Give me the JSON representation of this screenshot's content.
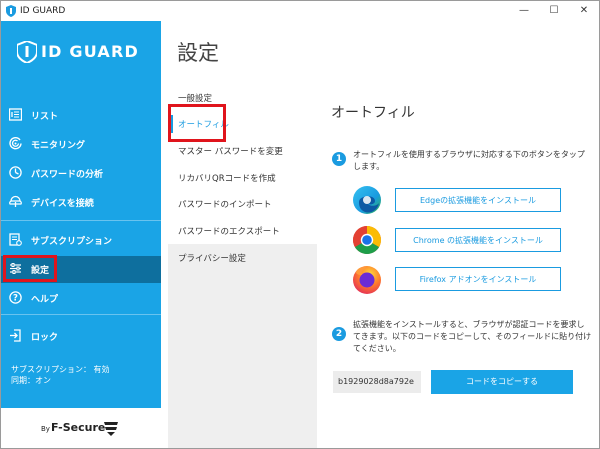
{
  "window": {
    "title": "ID GUARD",
    "minimize": "—",
    "maximize": "☐",
    "close": "✕"
  },
  "sidebar": {
    "logo_text": "ID GUARD",
    "items": [
      {
        "label": "リスト",
        "icon": "list-icon"
      },
      {
        "label": "モニタリング",
        "icon": "monitoring-icon"
      },
      {
        "label": "パスワードの分析",
        "icon": "password-analysis-icon"
      },
      {
        "label": "デバイスを接続",
        "icon": "connect-device-icon"
      },
      {
        "label": "サブスクリプション",
        "icon": "subscription-icon"
      },
      {
        "label": "設定",
        "icon": "settings-sliders-icon"
      },
      {
        "label": "ヘルプ",
        "icon": "help-icon"
      },
      {
        "label": "ロック",
        "icon": "lock-icon"
      }
    ],
    "subscription_status": "サブスクリプション： 有効",
    "sync_status": "同期：オン",
    "footer_by": "By",
    "footer_brand": "F-Secure"
  },
  "page": {
    "title": "設定"
  },
  "subnav": {
    "items": [
      {
        "label": "一般設定"
      },
      {
        "label": "オートフィル"
      },
      {
        "label": "マスター パスワードを変更"
      },
      {
        "label": "リカバリQRコードを作成"
      },
      {
        "label": "パスワードのインポート"
      },
      {
        "label": "パスワードのエクスポート"
      },
      {
        "label": "プライバシー設定"
      }
    ]
  },
  "autofill": {
    "title": "オートフィル",
    "step1_number": "1",
    "step1_line1": "オートフィルを使用するブラウザに対応する下のボタンをタップ",
    "step1_line2": "します。",
    "edge_button": "Edgeの拡張機能をインストール",
    "chrome_button": "Chrome の拡張機能をインストール",
    "firefox_button": "Firefox アドオンをインストール",
    "step2_number": "2",
    "step2_line1": "拡張機能をインストールすると、ブラウザが認証コードを要求し",
    "step2_line2": "てきます。以下のコードをコピーして、そのフィールドに貼り付け",
    "step2_line3": "てください。",
    "code": "b1929028d8a792e",
    "copy_button": "コードをコピーする"
  },
  "colors": {
    "accent": "#1aa4e6",
    "sidebar_active": "#0e6f9e",
    "highlight_red": "#e0141c"
  }
}
